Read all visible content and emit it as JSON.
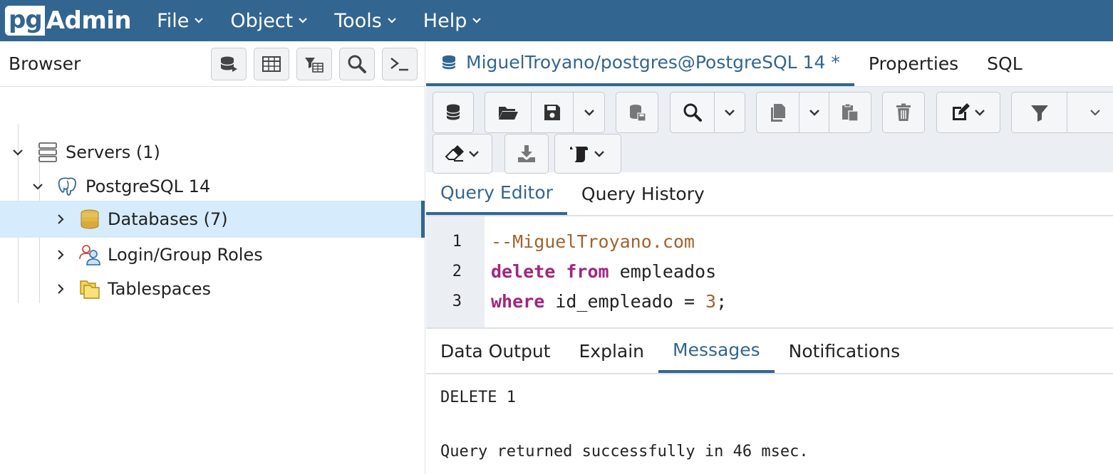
{
  "app": {
    "logo_pg": "pg",
    "logo_admin": "Admin"
  },
  "menu": [
    {
      "label": "File"
    },
    {
      "label": "Object"
    },
    {
      "label": "Tools"
    },
    {
      "label": "Help"
    }
  ],
  "browser": {
    "title": "Browser",
    "toolbar_icons": [
      "database-query-icon",
      "table-icon",
      "filter-table-icon",
      "search-icon",
      "terminal-icon"
    ],
    "tree": [
      {
        "label": "Servers (1)",
        "icon": "servers-icon",
        "expanded": true
      },
      {
        "label": "PostgreSQL 14",
        "icon": "postgresql-elephant-icon",
        "expanded": true
      },
      {
        "label": "Databases (7)",
        "icon": "databases-icon",
        "expanded": false,
        "selected": true
      },
      {
        "label": "Login/Group Roles",
        "icon": "roles-icon",
        "expanded": false
      },
      {
        "label": "Tablespaces",
        "icon": "tablespaces-icon",
        "expanded": false
      }
    ]
  },
  "tabs": {
    "query_tab": "MiguelTroyano/postgres@PostgreSQL 14 *",
    "properties": "Properties",
    "sql": "SQL"
  },
  "subtabs": {
    "editor": "Query Editor",
    "history": "Query History"
  },
  "editor": {
    "line_numbers": [
      "1",
      "2",
      "3"
    ],
    "line1_comment": "--MiguelTroyano.com",
    "line2_kw1": "delete",
    "line2_kw2": "from",
    "line2_rest": "empleados",
    "line3_kw": "where",
    "line3_mid": "id_empleado = ",
    "line3_num": "3",
    "line3_end": ";"
  },
  "output_tabs": {
    "data_output": "Data Output",
    "explain": "Explain",
    "messages": "Messages",
    "notifications": "Notifications"
  },
  "messages": {
    "line1": "DELETE 1",
    "line2": "Query returned successfully in 46 msec."
  },
  "colors": {
    "brand": "#326690",
    "selected_row": "#d6ebfb",
    "keyword": "#a3247f",
    "comment": "#a0642e"
  }
}
